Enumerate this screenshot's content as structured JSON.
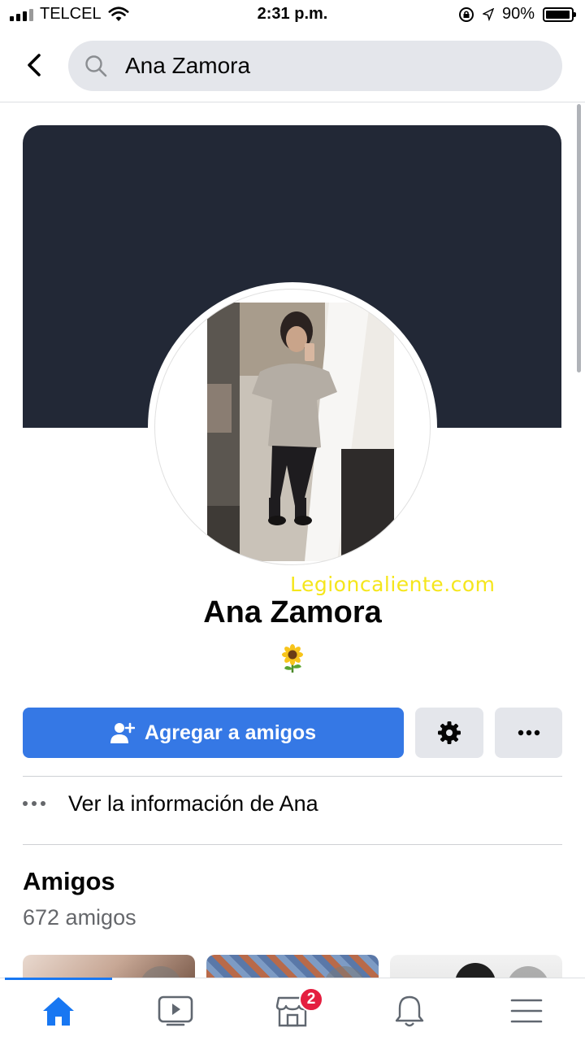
{
  "status_bar": {
    "carrier": "TELCEL",
    "time": "2:31 p.m.",
    "battery_percent": "90%",
    "icons": [
      "signal-icon",
      "wifi-icon",
      "rotation-lock-icon",
      "location-icon",
      "battery-icon"
    ]
  },
  "header": {
    "back_icon": "back-arrow-icon",
    "search_icon": "search-icon",
    "search_value": "Ana Zamora"
  },
  "profile": {
    "name": "Ana Zamora",
    "bio_emoji": "sunflower-icon",
    "watermark": "Legioncaliente.com",
    "colors": {
      "cover": "#222836",
      "primary_button": "#3578e5",
      "secondary_button": "#e4e6eb"
    }
  },
  "actions": {
    "add_friend_label": "Agregar a amigos",
    "add_friend_icon": "add-friend-icon",
    "settings_icon": "gear-icon",
    "more_icon": "more-icon"
  },
  "info_link": {
    "label": "Ver la información de Ana",
    "icon": "dots-icon"
  },
  "friends": {
    "title": "Amigos",
    "count_text": "672 amigos"
  },
  "bottom_nav": {
    "items": [
      {
        "name": "home",
        "icon": "home-icon",
        "active": true
      },
      {
        "name": "watch",
        "icon": "video-icon",
        "active": false
      },
      {
        "name": "marketplace",
        "icon": "marketplace-icon",
        "active": false,
        "badge": "2"
      },
      {
        "name": "notifications",
        "icon": "bell-icon",
        "active": false
      },
      {
        "name": "menu",
        "icon": "menu-icon",
        "active": false
      }
    ]
  }
}
